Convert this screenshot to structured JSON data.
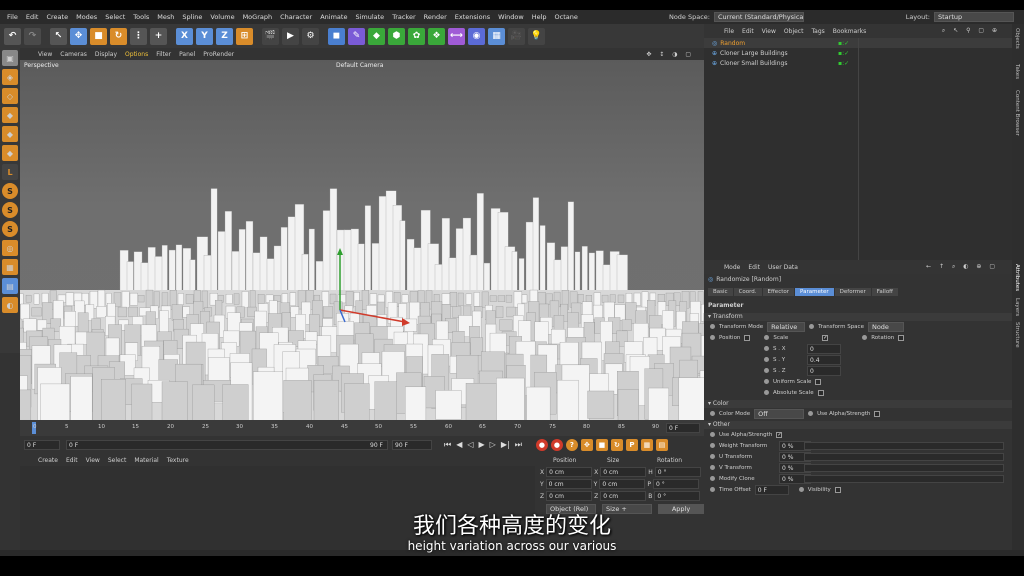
{
  "menu": [
    "File",
    "Edit",
    "Create",
    "Modes",
    "Select",
    "Tools",
    "Mesh",
    "Spline",
    "Volume",
    "MoGraph",
    "Character",
    "Animate",
    "Simulate",
    "Tracker",
    "Render",
    "Extensions",
    "Window",
    "Help",
    "Octane"
  ],
  "node_space": {
    "label": "Node Space:",
    "value": "Current (Standard/Physical)"
  },
  "layout": {
    "label": "Layout:",
    "value": "Startup"
  },
  "toolbar_xyz": [
    "X",
    "Y",
    "Z"
  ],
  "viewport": {
    "menu": [
      "View",
      "Cameras",
      "Display",
      "Options",
      "Filter",
      "Panel",
      "ProRender"
    ],
    "label": "Perspective",
    "camera": "Default Camera"
  },
  "timeline": {
    "ticks": [
      "0",
      "5",
      "10",
      "15",
      "20",
      "25",
      "30",
      "35",
      "40",
      "45",
      "50",
      "55",
      "60",
      "65",
      "70",
      "75",
      "80",
      "85",
      "90"
    ],
    "current_frame": "0 F",
    "start": "0 F",
    "range_start": "0 F",
    "range_end": "90 F",
    "end": "90 F"
  },
  "material_menu": [
    "Create",
    "Edit",
    "View",
    "Select",
    "Material",
    "Texture"
  ],
  "coords": {
    "headers": [
      "Position",
      "Size",
      "Rotation"
    ],
    "rows": [
      {
        "a": "X",
        "pos": "0 cm",
        "b": "X",
        "size": "0 cm",
        "c": "H",
        "rot": "0 °"
      },
      {
        "a": "Y",
        "pos": "0 cm",
        "b": "Y",
        "size": "0 cm",
        "c": "P",
        "rot": "0 °"
      },
      {
        "a": "Z",
        "pos": "0 cm",
        "b": "Z",
        "size": "0 cm",
        "c": "B",
        "rot": "0 °"
      }
    ],
    "mode": "Object (Rel)",
    "size_mode": "Size +",
    "apply": "Apply"
  },
  "objects": {
    "menu": [
      "File",
      "Edit",
      "View",
      "Object",
      "Tags",
      "Bookmarks"
    ],
    "items": [
      "Random",
      "Cloner Large Buildings",
      "Cloner Small Buildings"
    ]
  },
  "attributes": {
    "menu": [
      "Mode",
      "Edit",
      "User Data"
    ],
    "title": "Randomize [Random]",
    "tabs": [
      "Basic",
      "Coord.",
      "Effector",
      "Parameter",
      "Deformer",
      "Falloff"
    ],
    "section": "Parameter",
    "transform": {
      "header": "Transform",
      "mode_label": "Transform Mode",
      "mode_value": "Relative",
      "space_label": "Transform Space",
      "space_value": "Node",
      "position": "Position",
      "scale": "Scale",
      "rotation": "Rotation",
      "sx": "S . X",
      "sx_val": "0",
      "sy": "S . Y",
      "sy_val": "0.4",
      "sz": "S . Z",
      "sz_val": "0",
      "uniform": "Uniform Scale",
      "absolute": "Absolute Scale"
    },
    "color": {
      "header": "Color",
      "mode_label": "Color Mode",
      "mode_value": "Off",
      "alpha": "Use Alpha/Strength"
    },
    "other": {
      "header": "Other",
      "alpha": "Use Alpha/Strength",
      "weight": "Weight Transform",
      "weight_val": "0 %",
      "u": "U Transform",
      "u_val": "0 %",
      "v": "V Transform",
      "v_val": "0 %",
      "modify": "Modify Clone",
      "modify_val": "0 %",
      "time": "Time Offset",
      "time_val": "0 F",
      "visibility": "Visibility"
    }
  },
  "right_tabs": [
    "Objects",
    "Takes",
    "Content Browser",
    "Attributes",
    "Layers",
    "Structure"
  ],
  "subtitle": {
    "zh": "我们各种高度的变化",
    "en": "height variation across our various"
  }
}
